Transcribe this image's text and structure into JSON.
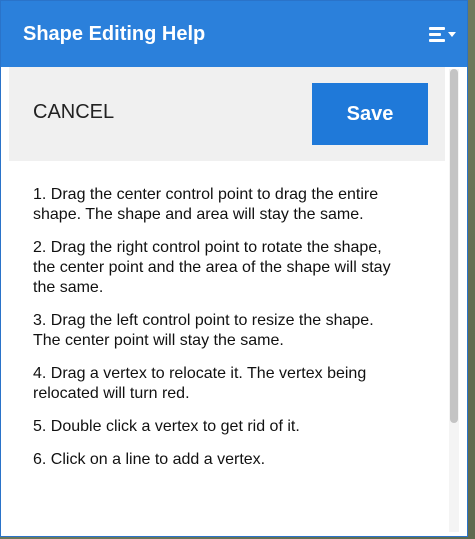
{
  "header": {
    "title": "Shape Editing Help",
    "menu_icon": "menu-list-icon"
  },
  "actions": {
    "cancel_label": "CANCEL",
    "save_label": "Save"
  },
  "instructions": [
    "1.  Drag the center control point to drag the entire shape. The shape and area will stay the same.",
    "2.  Drag the right control point to rotate the shape, the center point and the area of the shape will stay the same.",
    "3.  Drag the left control point to resize the shape. The center point will stay the same.",
    "4.  Drag a vertex to relocate it. The vertex being relocated will turn red.",
    "5.  Double click a vertex to get rid of it.",
    "6.  Click on a line to add a vertex."
  ],
  "colors": {
    "header_bg": "#2b80db",
    "save_bg": "#1f79d9",
    "actionbar_bg": "#f0f0f0"
  }
}
